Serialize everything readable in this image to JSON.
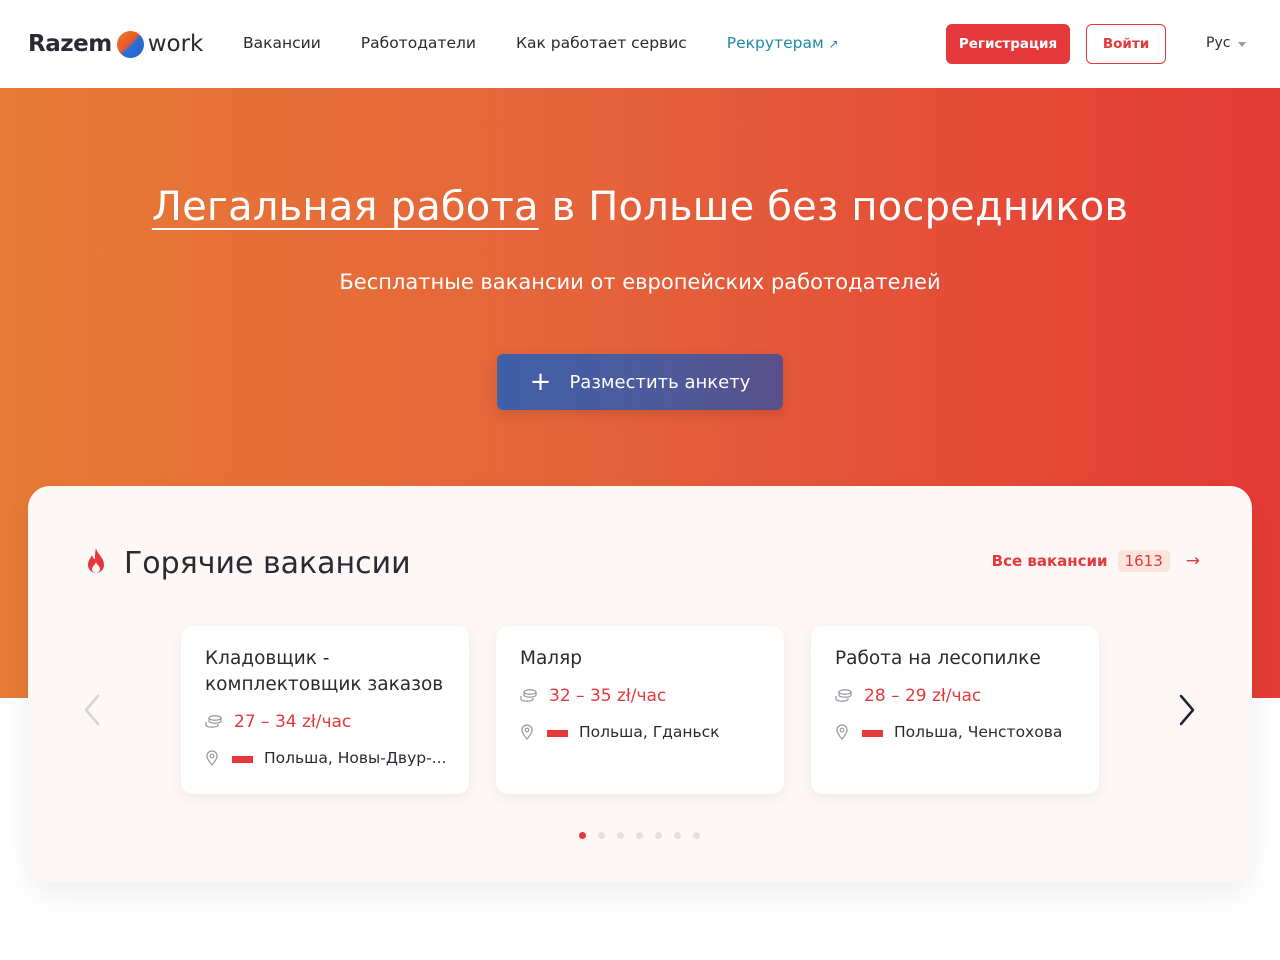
{
  "logo": {
    "part1": "Razem",
    "part2": "work"
  },
  "nav": {
    "items": [
      "Вакансии",
      "Работодатели",
      "Как работает сервис"
    ],
    "recruit": "Рекрутерам",
    "recruit_arrow": "↗"
  },
  "header": {
    "register": "Регистрация",
    "login": "Войти",
    "lang": "Рус"
  },
  "hero": {
    "title_highlight": "Легальная работа",
    "title_rest": " в Польше без посредников",
    "subtitle": "Бесплатные вакансии от европейских работодателей",
    "cta_plus": "+",
    "cta": "Разместить анкету"
  },
  "hot": {
    "title": "Горячие вакансии",
    "all_label": "Все вакансии",
    "all_count": "1613",
    "all_arrow": "→",
    "cards": [
      {
        "title": "Кладовщик - комплектовщик заказов",
        "salary": "27 – 34 zł/час",
        "location": "Польша, Новы-Двур-..."
      },
      {
        "title": "Маляр",
        "salary": "32 – 35 zł/час",
        "location": "Польша, Гданьск"
      },
      {
        "title": "Работа на лесопилке",
        "salary": "28 – 29 zł/час",
        "location": "Польша, Ченстохова"
      }
    ],
    "pagination": {
      "total": 7,
      "active": 1
    }
  },
  "colors": {
    "accent": "#e5383b",
    "recruit_link": "#1e8aa8",
    "cta": "#4e5a9a"
  },
  "icons": [
    "fire-icon",
    "coins-icon",
    "location-pin-icon",
    "poland-flag-icon",
    "chevron-left-icon",
    "chevron-right-icon",
    "arrow-right-icon",
    "external-link-icon",
    "plus-icon",
    "caret-down-icon"
  ]
}
